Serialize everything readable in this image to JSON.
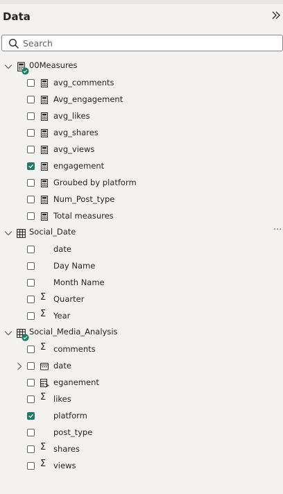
{
  "pane": {
    "title": "Data",
    "collapse_icon": "chevron-double-right-icon"
  },
  "search": {
    "placeholder": "Search",
    "value": ""
  },
  "colors": {
    "accent": "#1f7a66",
    "background": "#f3f2f1"
  },
  "tables": [
    {
      "name": "00Measures",
      "expanded": true,
      "fields": [
        {
          "label": "avg_comments",
          "icon": "calculator-icon",
          "checked": false
        },
        {
          "label": "Avg_engagement",
          "icon": "calculator-icon",
          "checked": false
        },
        {
          "label": "avg_likes",
          "icon": "calculator-icon",
          "checked": false
        },
        {
          "label": "avg_shares",
          "icon": "calculator-icon",
          "checked": false
        },
        {
          "label": "avg_views",
          "icon": "calculator-icon",
          "checked": false
        },
        {
          "label": "engagement",
          "icon": "calculator-icon",
          "checked": true
        },
        {
          "label": "Groubed by platform",
          "icon": "calculator-icon",
          "checked": false
        },
        {
          "label": "Num_Post_type",
          "icon": "calculator-icon",
          "checked": false
        },
        {
          "label": "Total measures",
          "icon": "calculator-icon",
          "checked": false
        }
      ]
    },
    {
      "name": "Social_Date",
      "expanded": true,
      "more_label": "···",
      "fields": [
        {
          "label": "date",
          "icon": "none",
          "checked": false
        },
        {
          "label": "Day Name",
          "icon": "none",
          "checked": false
        },
        {
          "label": "Month Name",
          "icon": "none",
          "checked": false
        },
        {
          "label": "Quarter",
          "icon": "sigma-icon",
          "checked": false
        },
        {
          "label": "Year",
          "icon": "sigma-icon",
          "checked": false
        }
      ]
    },
    {
      "name": "Social_Media_Analysis",
      "expanded": true,
      "fields": [
        {
          "label": "comments",
          "icon": "sigma-icon",
          "checked": false
        },
        {
          "label": "date",
          "icon": "calendar-icon",
          "checked": false,
          "expandable": true
        },
        {
          "label": "eganement",
          "icon": "calculated-column-icon",
          "checked": false
        },
        {
          "label": "likes",
          "icon": "sigma-icon",
          "checked": false
        },
        {
          "label": "platform",
          "icon": "none",
          "checked": true
        },
        {
          "label": "post_type",
          "icon": "none",
          "checked": false
        },
        {
          "label": "shares",
          "icon": "sigma-icon",
          "checked": false
        },
        {
          "label": "views",
          "icon": "sigma-icon",
          "checked": false
        }
      ]
    }
  ]
}
